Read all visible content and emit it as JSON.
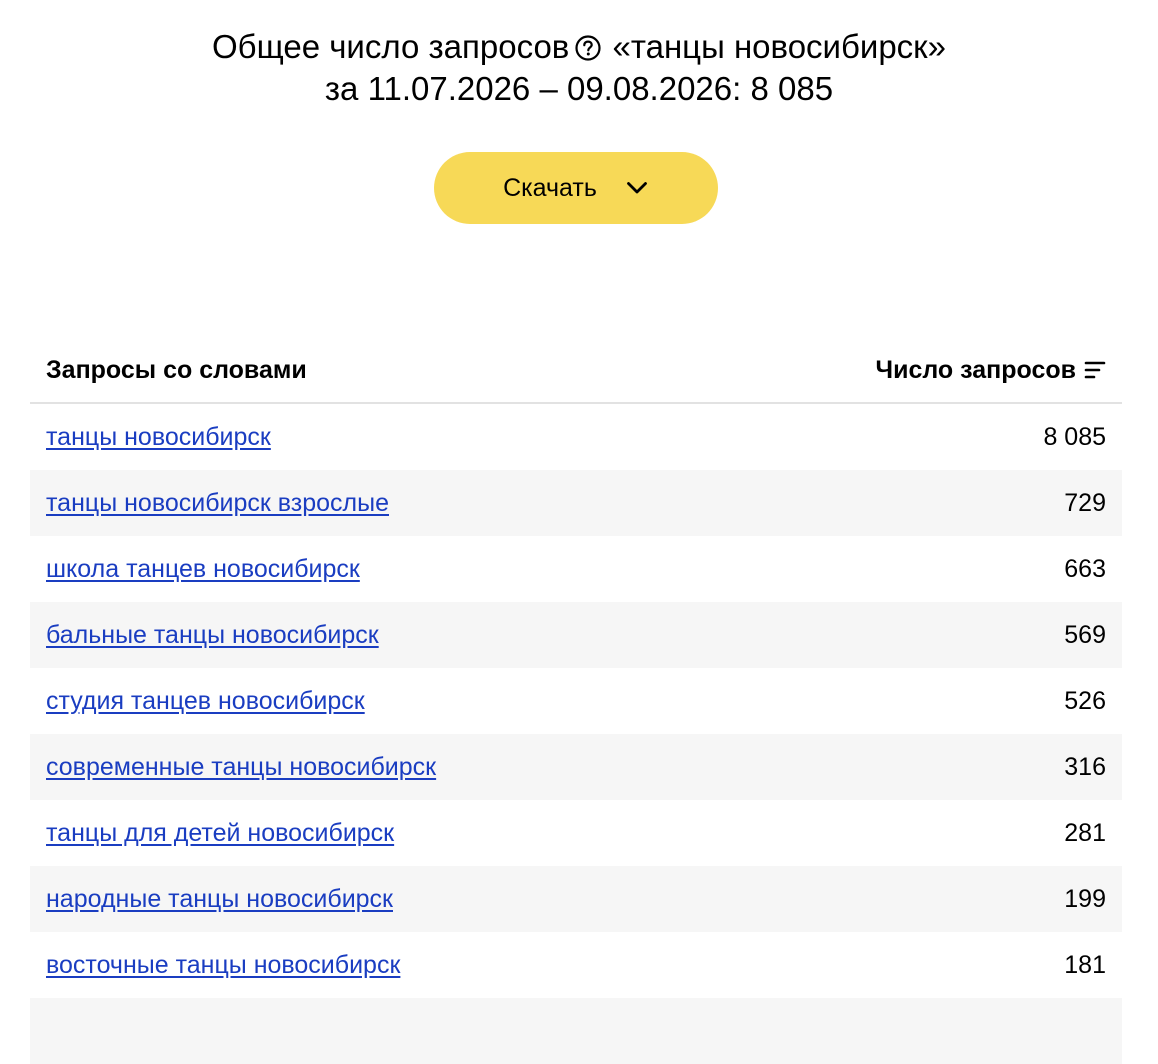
{
  "header": {
    "title_prefix": "Общее число запросов",
    "title_query": "«танцы новосибирск»",
    "period_label": "за 11.07.2026 – 09.08.2026: 8 085"
  },
  "download_button": {
    "label": "Скачать",
    "color": "#f7d957"
  },
  "table": {
    "column_headers": {
      "query": "Запросы со словами",
      "count": "Число запросов"
    },
    "link_color": "#1a3dc1",
    "rows": [
      {
        "query": "танцы новосибирск",
        "count": "8 085"
      },
      {
        "query": "танцы новосибирск взрослые",
        "count": "729"
      },
      {
        "query": "школа танцев новосибирск",
        "count": "663"
      },
      {
        "query": "бальные танцы новосибирск",
        "count": "569"
      },
      {
        "query": "студия танцев новосибирск",
        "count": "526"
      },
      {
        "query": "современные танцы новосибирск",
        "count": "316"
      },
      {
        "query": "танцы для детей новосибирск",
        "count": "281"
      },
      {
        "query": "народные танцы новосибирск",
        "count": "199"
      },
      {
        "query": "восточные танцы новосибирск",
        "count": "181"
      }
    ]
  },
  "icons": {
    "help": "help-circle-icon",
    "download_chevron": "chevron-down-icon",
    "sort": "sort-descending-icon"
  }
}
